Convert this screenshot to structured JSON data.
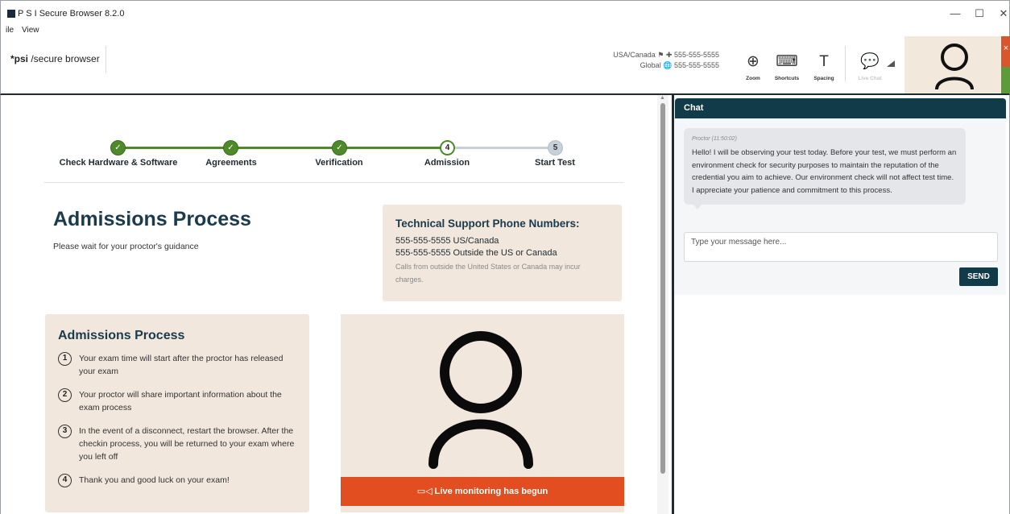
{
  "window": {
    "title": "P S I Secure Browser 8.2.0",
    "min_glyph": "—",
    "max_glyph": "☐",
    "close_glyph": "✕"
  },
  "menu": {
    "items": [
      "ile",
      "View"
    ]
  },
  "toolbar": {
    "brand_bold": "*psi",
    "brand_rest": " /secure browser",
    "phones": [
      {
        "label": "USA/Canada",
        "icons": "⚑ ✚",
        "number": "555-555-5555"
      },
      {
        "label": "Global",
        "icons": "🌐",
        "number": "555-555-5555"
      }
    ],
    "tools": [
      {
        "label": "Zoom",
        "icon": "zoom-in-icon",
        "glyph": "⊕",
        "enabled": true
      },
      {
        "label": "Shortcuts",
        "icon": "keyboard-icon",
        "glyph": "⌨",
        "enabled": true
      },
      {
        "label": "Spacing",
        "icon": "text-spacing-icon",
        "glyph": "T",
        "enabled": true
      },
      {
        "label": "Live Chat",
        "icon": "chat-bubble-icon",
        "glyph": "💬",
        "enabled": false
      }
    ],
    "camera_close_glyph": "×"
  },
  "stepper": {
    "steps": [
      {
        "label": "Check Hardware & Software",
        "state": "done",
        "marker": "✓"
      },
      {
        "label": "Agreements",
        "state": "done",
        "marker": "✓"
      },
      {
        "label": "Verification",
        "state": "done",
        "marker": "✓"
      },
      {
        "label": "Admission",
        "state": "current",
        "marker": "4"
      },
      {
        "label": "Start Test",
        "state": "todo",
        "marker": "5"
      }
    ]
  },
  "main": {
    "title": "Admissions Process",
    "subtitle": "Please wait for your proctor's guidance"
  },
  "support": {
    "title": "Technical Support Phone Numbers:",
    "lines": [
      "555-555-5555  US/Canada",
      "555-555-5555  Outside the US or Canada"
    ],
    "note": "Calls from outside the United States or Canada may incur charges."
  },
  "process": {
    "title": "Admissions Process",
    "items": [
      {
        "num": "1",
        "text": "Your exam time will start after the proctor has released your exam"
      },
      {
        "num": "2",
        "text": "Your proctor will share important information about the exam process"
      },
      {
        "num": "3",
        "text": "In the event of a disconnect, restart the browser. After the checkin process, you will be returned to your exam where you left off"
      },
      {
        "num": "4",
        "text": "Thank you and good luck on your exam!"
      }
    ]
  },
  "video": {
    "status": "Live monitoring has begun"
  },
  "chat": {
    "header": "Chat",
    "message": {
      "meta": "Proctor (11:50:02)",
      "text": "Hello! I will be observing your test today. Before your test, we must perform an environment check for security purposes to maintain the reputation of the credential you aim to achieve. Our environment check will not affect test time. I appreciate your patience and commitment to this process."
    },
    "input_placeholder": "Type your message here...",
    "send_label": "SEND"
  },
  "colors": {
    "accent_green": "#4e8a2a",
    "navy": "#123b4a",
    "card_beige": "#f1e7dc",
    "alert_orange": "#e24e20"
  }
}
